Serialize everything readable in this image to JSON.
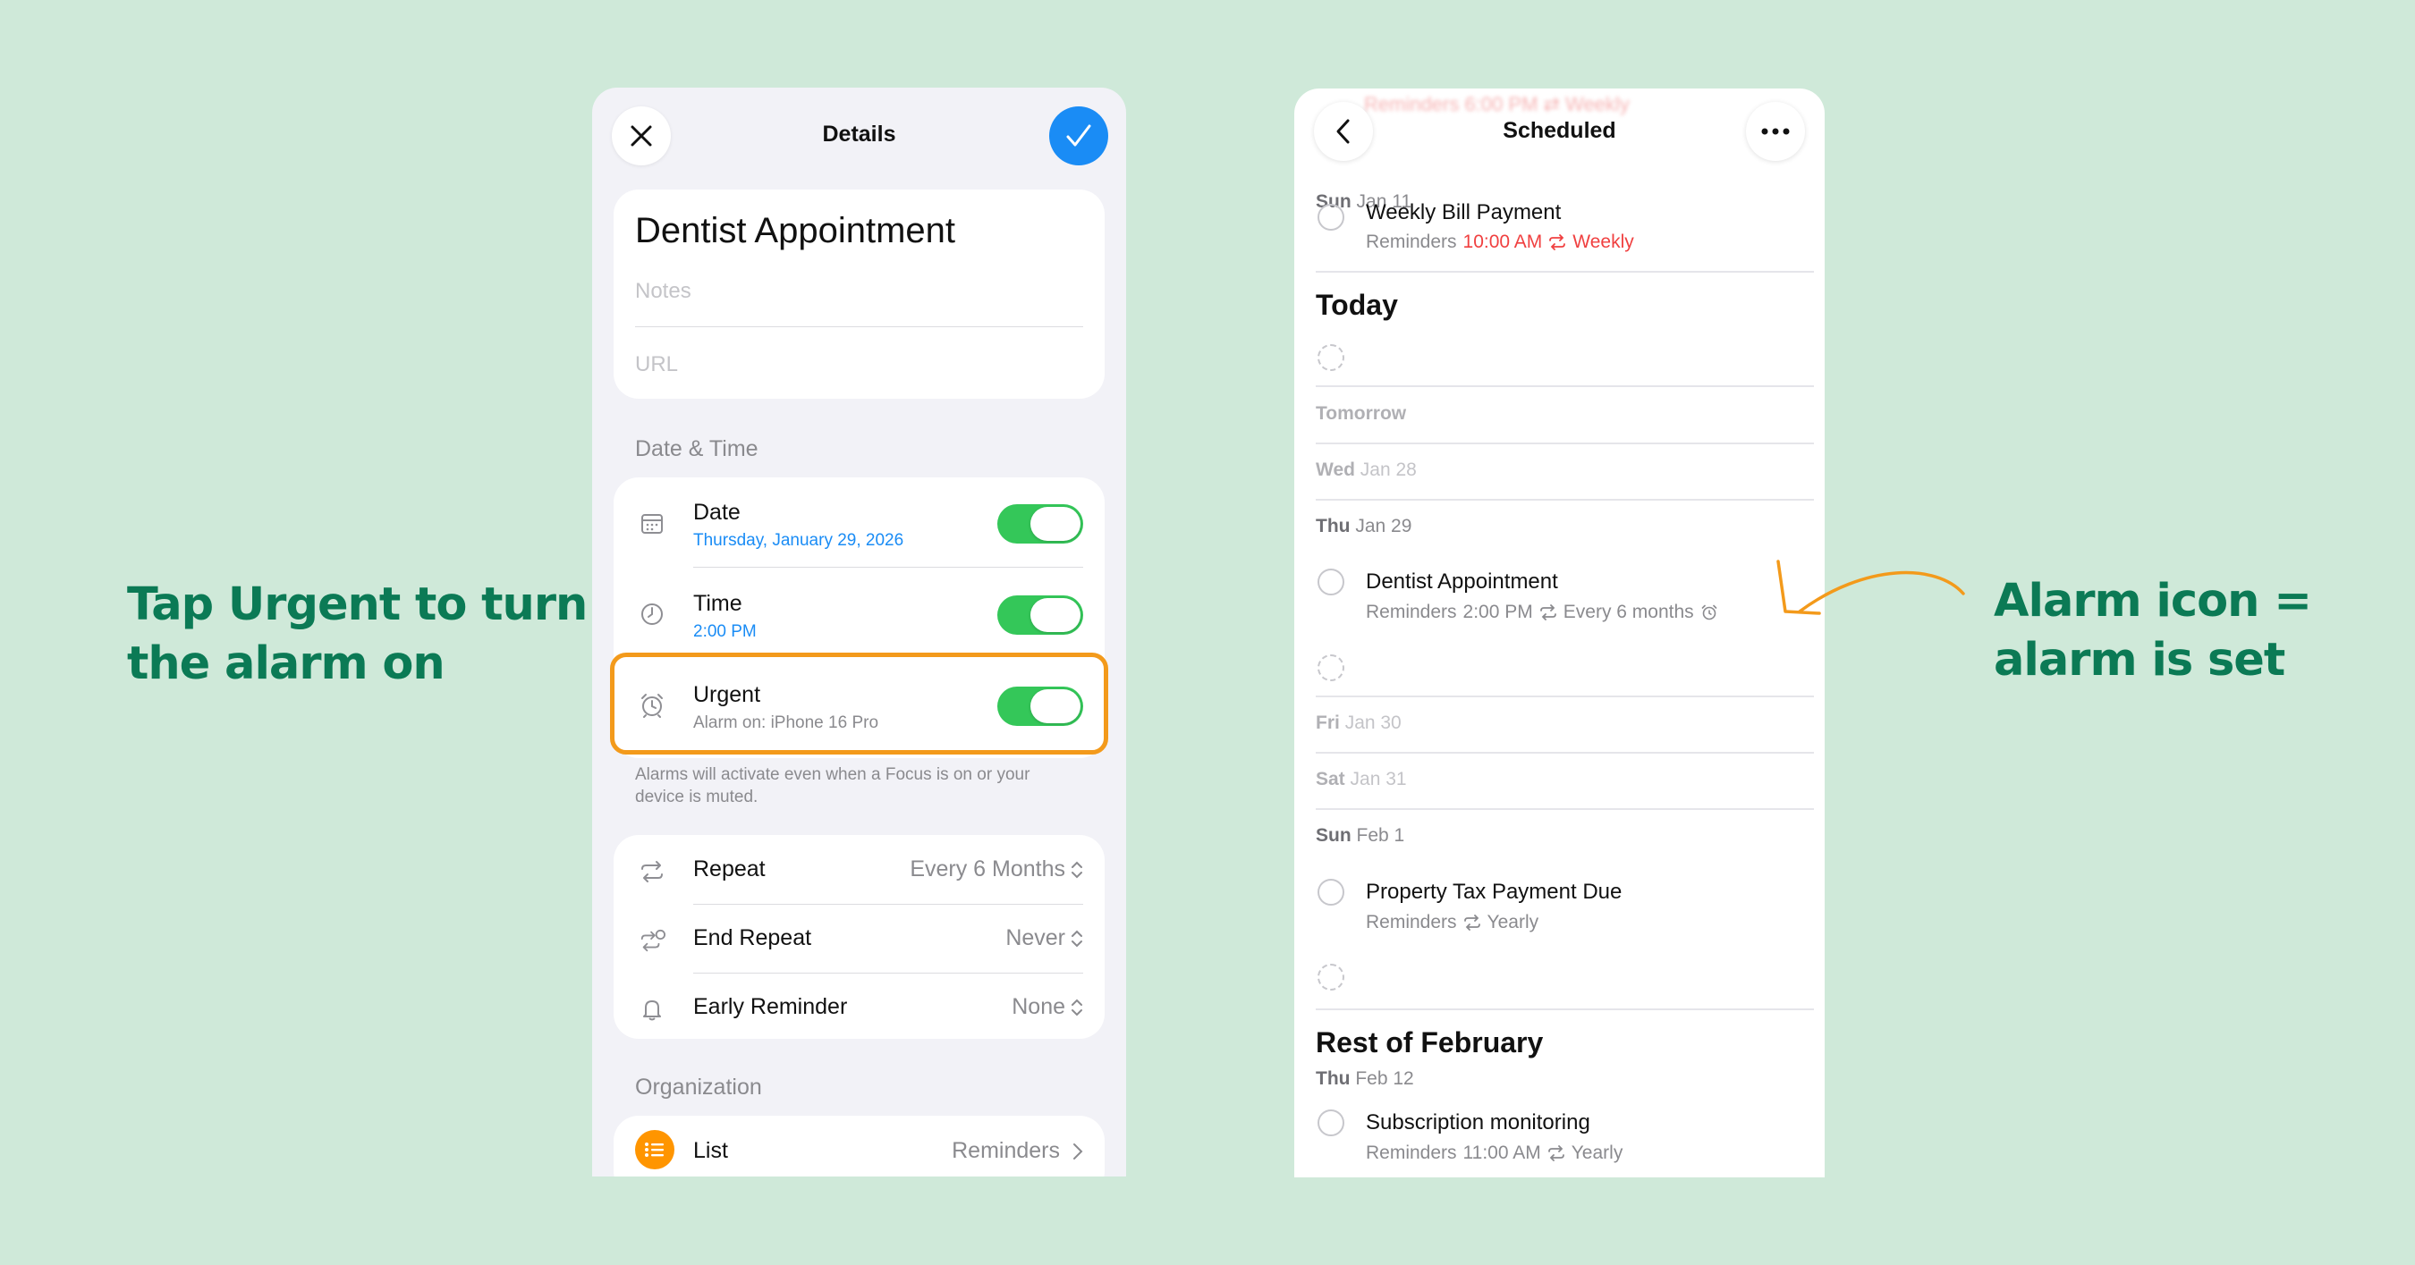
{
  "captions": {
    "left": [
      "Tap Urgent to turn",
      "the alarm on"
    ],
    "right": [
      "Alarm icon =",
      "alarm is set"
    ]
  },
  "details": {
    "nav_title": "Details",
    "title": "Dentist Appointment",
    "notes_placeholder": "Notes",
    "url_placeholder": "URL",
    "date_time_section": "Date & Time",
    "date": {
      "label": "Date",
      "value": "Thursday, January 29, 2026",
      "on": true
    },
    "time": {
      "label": "Time",
      "value": "2:00 PM",
      "on": true
    },
    "urgent": {
      "label": "Urgent",
      "value": "Alarm on: iPhone 16 Pro",
      "on": true
    },
    "alarm_note": "Alarms will activate even when a Focus is on or your device is muted.",
    "repeat": {
      "label": "Repeat",
      "value": "Every 6 Months"
    },
    "end_repeat": {
      "label": "End Repeat",
      "value": "Never"
    },
    "early_reminder": {
      "label": "Early Reminder",
      "value": "None"
    },
    "organization_section": "Organization",
    "list": {
      "label": "List",
      "value": "Reminders"
    }
  },
  "scheduled": {
    "ghost_header": "Reminders  6:00 PM  ⇄ Weekly",
    "nav_title": "Scheduled",
    "sun_jan_11": {
      "day": "Sun",
      "date": "Jan 11"
    },
    "weekly_bill": {
      "title": "Weekly Bill Payment",
      "list": "Reminders",
      "time": "10:00 AM",
      "repeat": "Weekly"
    },
    "today": "Today",
    "tomorrow": "Tomorrow",
    "wed": {
      "day": "Wed",
      "date": "Jan 28"
    },
    "thu": {
      "day": "Thu",
      "date": "Jan 29"
    },
    "dentist": {
      "title": "Dentist Appointment",
      "list": "Reminders",
      "time": "2:00 PM",
      "repeat": "Every 6 months"
    },
    "fri": {
      "day": "Fri",
      "date": "Jan 30"
    },
    "sat": {
      "day": "Sat",
      "date": "Jan 31"
    },
    "sun_feb": {
      "day": "Sun",
      "date": "Feb 1"
    },
    "property": {
      "title": "Property Tax Payment Due",
      "list": "Reminders",
      "repeat": "Yearly"
    },
    "rest_of_feb": "Rest of February",
    "thu_feb": {
      "day": "Thu",
      "date": "Feb 12"
    },
    "subscription": {
      "title": "Subscription monitoring",
      "list": "Reminders",
      "time": "11:00 AM",
      "repeat": "Yearly"
    }
  },
  "colors": {
    "background": "#cfe9d9",
    "caption": "#0b7a55",
    "highlight": "#f39a1b",
    "toggle_on": "#34c759",
    "accent_blue": "#1a8cf5",
    "red": "#f04040"
  }
}
